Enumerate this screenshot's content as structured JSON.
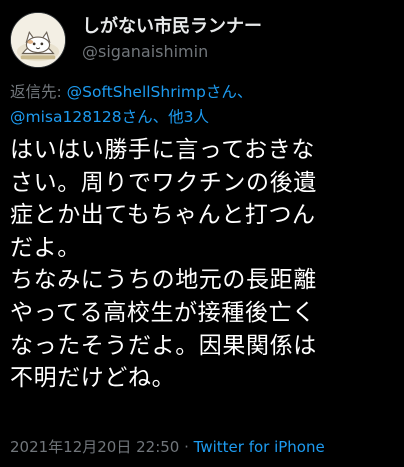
{
  "author": {
    "display_name": "しがない市民ランナー",
    "username": "@siganaishimin",
    "avatar": "cat-illustration-avatar"
  },
  "reply": {
    "prefix": "返信先: ",
    "mention1": "@SoftShellShrimp",
    "suffix1": "さん、",
    "mention2": "@misa128128",
    "suffix2": "さん、",
    "others": "他3人"
  },
  "tweet": {
    "lines": [
      "はいはい勝手に言っておきな",
      "さい。周りでワクチンの後遺",
      "症とか出てもちゃんと打つん",
      "だよ。",
      "ちなみにうちの地元の長距離",
      "やってる高校生が接種後亡く",
      "なったそうだよ。因果関係は",
      "不明だけどね。"
    ]
  },
  "meta": {
    "timestamp": "2021年12月20日 22:50",
    "separator": " · ",
    "source": "Twitter for iPhone"
  },
  "colors": {
    "background": "#000000",
    "text": "#ffffff",
    "secondary": "#71767b",
    "link": "#1d9bf0"
  }
}
